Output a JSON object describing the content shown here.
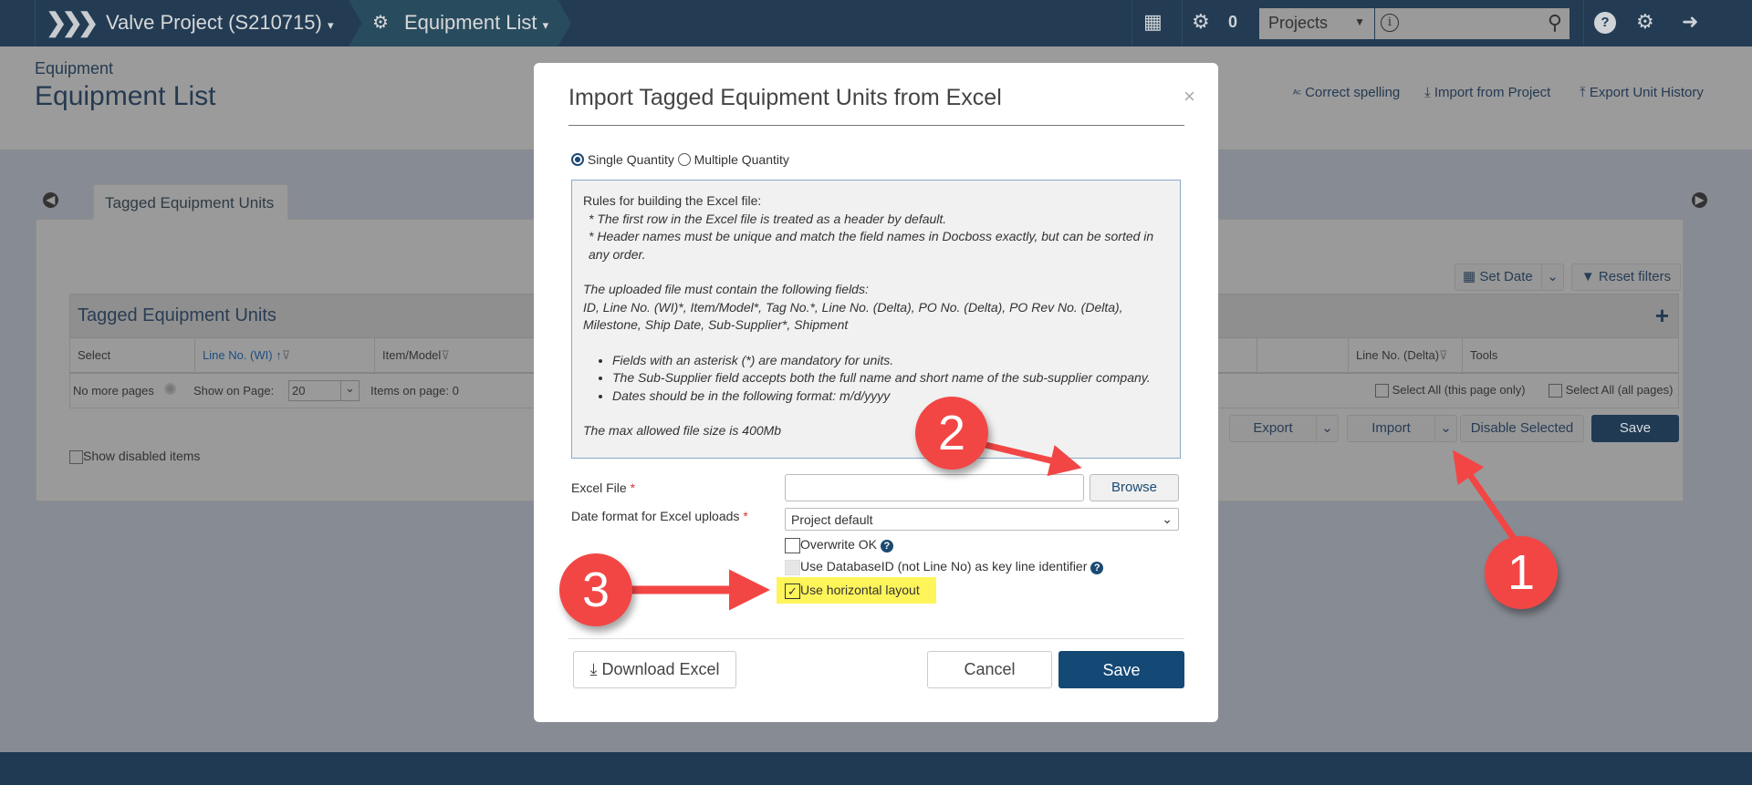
{
  "topbar": {
    "project": "Valve Project (S210715)",
    "module": "Equipment List",
    "task_count": "0",
    "search_scope": "Projects",
    "search_placeholder": ""
  },
  "header": {
    "breadcrumb": "Equipment",
    "title": "Equipment List",
    "links": [
      "Correct spelling",
      "Import from Project",
      "Export Unit History"
    ]
  },
  "tab": {
    "label": "Tagged Equipment Units"
  },
  "toolbar": {
    "set_date": "Set Date",
    "reset_filters": "Reset filters"
  },
  "table": {
    "title": "Tagged Equipment Units",
    "columns": [
      "Select",
      "Line No. (WI)",
      "Item/Model",
      "Line No. (Delta)",
      "Tools"
    ],
    "pager": {
      "no_more": "No more pages",
      "show_on_page_label": "Show on Page:",
      "show_on_page_value": "20",
      "items_on_page": "Items on page: 0",
      "select_all_page": "Select All (this page only)",
      "select_all_pages": "Select All (all pages)"
    }
  },
  "actions": {
    "export": "Export",
    "import": "Import",
    "disable_selected": "Disable Selected",
    "save": "Save"
  },
  "show_disabled": "Show disabled items",
  "modal": {
    "title": "Import Tagged Equipment Units from Excel",
    "close": "×",
    "radio_single": "Single Quantity",
    "radio_multiple": "Multiple Quantity",
    "selected_mode": "Single Quantity",
    "rules": {
      "heading": "Rules for building the Excel file:",
      "line1": "* The first row in the Excel file is treated as a header by default.",
      "line2": "* Header names must be unique and match the field names in Docboss exactly, but can be sorted in any order.",
      "fields_heading": "The uploaded file must contain the following fields:",
      "fields": "ID, Line No. (WI)*, Item/Model*, Tag No.*, Line No. (Delta), PO No. (Delta), PO Rev No. (Delta), Milestone, Ship Date, Sub-Supplier*, Shipment",
      "bullets": [
        "Fields with an asterisk (*) are mandatory for units.",
        "The Sub-Supplier field accepts both the full name and short name of the sub-supplier company.",
        "Dates should be in the following format: m/d/yyyy"
      ],
      "max_size": "The max allowed file size is 400Mb"
    },
    "excel_file_label": "Excel File",
    "excel_file_value": "",
    "browse": "Browse",
    "date_format_label": "Date format for Excel uploads",
    "date_format_value": "Project default",
    "overwrite": "Overwrite OK",
    "database_id": "Use DatabaseID (not Line No) as key line identifier",
    "horizontal": "Use horizontal layout",
    "download": "Download Excel",
    "cancel": "Cancel",
    "save": "Save"
  },
  "annotations": [
    "1",
    "2",
    "3"
  ],
  "colors": {
    "primary": "#1b4a73",
    "annotation": "#f24645",
    "highlight": "#fef55a",
    "topbar": "#233c54"
  }
}
